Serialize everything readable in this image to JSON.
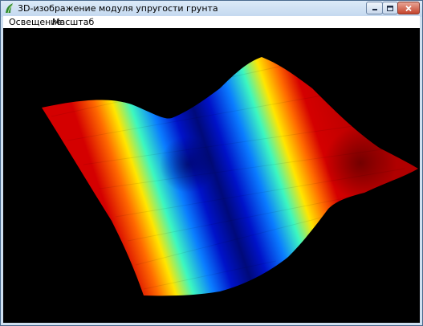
{
  "window": {
    "title": "3D-изображение модуля упругости грунта"
  },
  "menu": {
    "items": [
      {
        "label": "Освещение"
      },
      {
        "label": "Масштаб"
      }
    ]
  },
  "viewport": {
    "background": "#000000",
    "colormap": "jet",
    "colormap_stops": [
      "#d40000",
      "#ff6a00",
      "#ffe600",
      "#3cf7c0",
      "#0a7cff",
      "#0012c8",
      "#000a7a"
    ]
  }
}
